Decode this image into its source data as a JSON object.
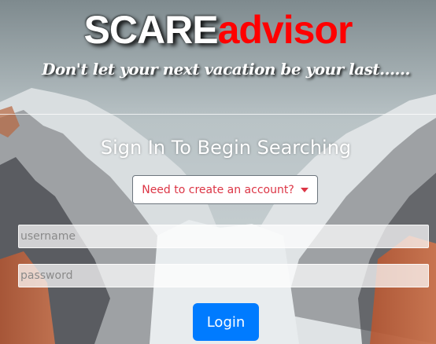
{
  "brand": {
    "name_white": "SCARE",
    "name_red": "advisor",
    "tagline": "Don't let your next vacation be your last......"
  },
  "form": {
    "heading": "Sign In To Begin Searching",
    "create_account_label": "Need to create an account?",
    "username_placeholder": "username",
    "password_placeholder": "password",
    "login_label": "Login"
  },
  "icons": {
    "dropdown_caret": "caret-down-icon"
  },
  "colors": {
    "brand_red": "#ff0000",
    "dropdown_text": "#dc3545",
    "login_button": "#007bff"
  }
}
